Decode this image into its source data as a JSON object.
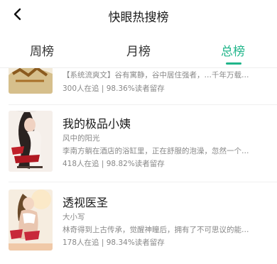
{
  "header": {
    "title": "快眼热搜榜",
    "back_icon": "chevron-left-icon"
  },
  "tabs": [
    {
      "label": "周榜",
      "active": false
    },
    {
      "label": "月榜",
      "active": false
    },
    {
      "label": "总榜",
      "active": true
    }
  ],
  "accent_color": "#20b58a",
  "books": [
    {
      "title": "",
      "author": "",
      "desc": "【系统流爽文】谷有寓静，谷中居住强者，…千年万载…",
      "stats": "300人在追 | 98.36%读者留存"
    },
    {
      "title": "我的极品小姨",
      "author": "风中的阳光",
      "desc": "李南方躺在酒店的浴缸里，正在舒服的泡澡，忽然一个…",
      "stats": "418人在追 | 98.82%读者留存"
    },
    {
      "title": "透视医圣",
      "author": "大小写",
      "desc": "林奇得到上古传承，觉醒神瞳后，拥有了不可思议的能…",
      "stats": "178人在追 | 98.34%读者留存"
    }
  ]
}
